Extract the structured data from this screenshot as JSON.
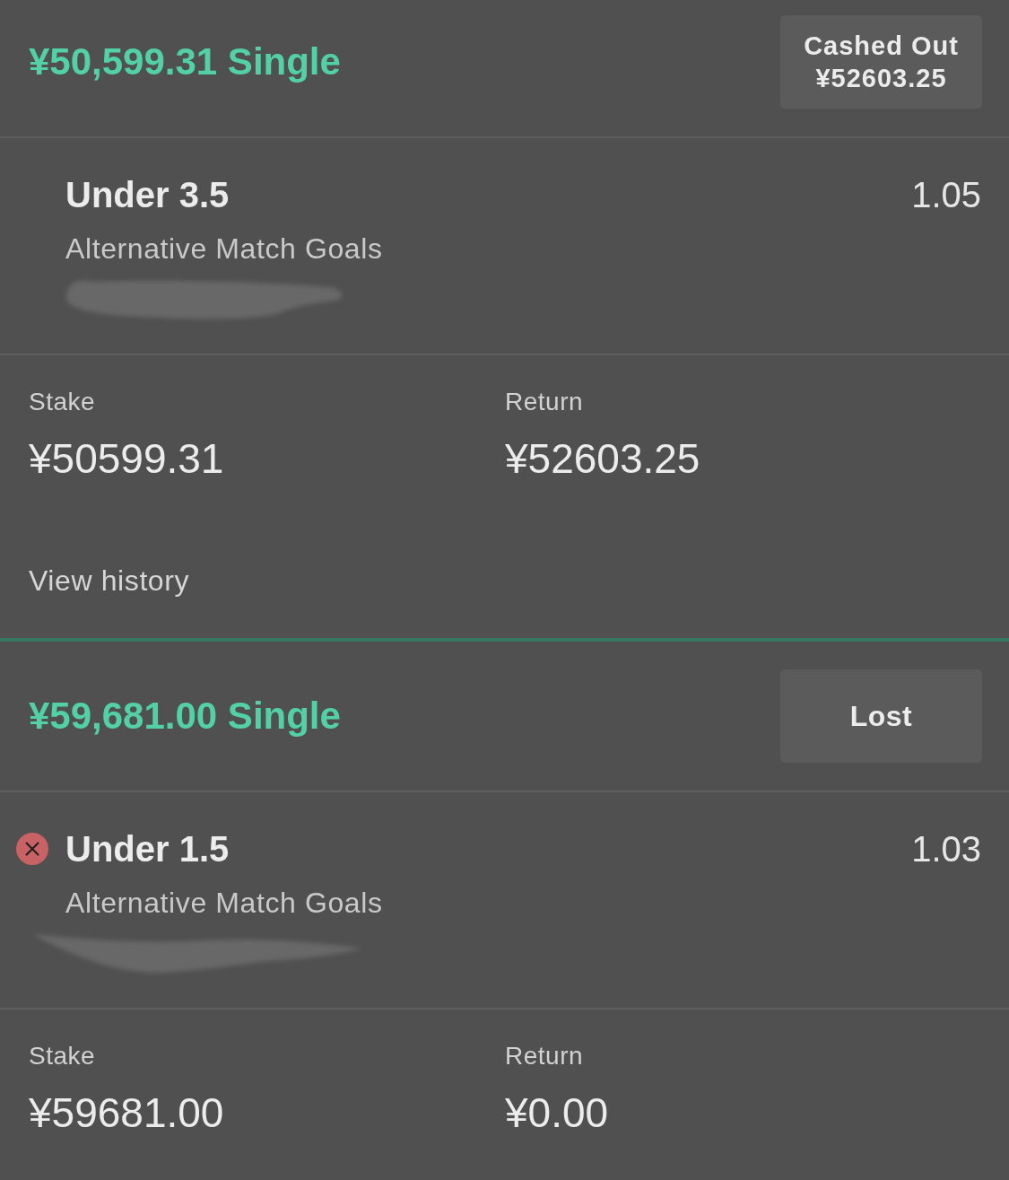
{
  "bets": [
    {
      "title": "¥50,599.31 Single",
      "status": {
        "kind": "cashed_out",
        "lines": [
          "Cashed Out",
          "¥52603.25"
        ]
      },
      "selection": {
        "name": "Under 3.5",
        "odds": "1.05",
        "market": "Alternative Match Goals",
        "lost": false,
        "redacted": true
      },
      "totals": [
        {
          "label": "Stake",
          "value": "¥50599.31"
        },
        {
          "label": "Return",
          "value": "¥52603.25"
        }
      ],
      "link": "View history"
    },
    {
      "title": "¥59,681.00 Single",
      "status": {
        "kind": "lost",
        "lines": [
          "Lost"
        ]
      },
      "selection": {
        "name": "Under 1.5",
        "odds": "1.03",
        "market": "Alternative Match Goals",
        "lost": true,
        "redacted": true
      },
      "totals": [
        {
          "label": "Stake",
          "value": "¥59681.00"
        },
        {
          "label": "Return",
          "value": "¥0.00"
        }
      ]
    }
  ]
}
